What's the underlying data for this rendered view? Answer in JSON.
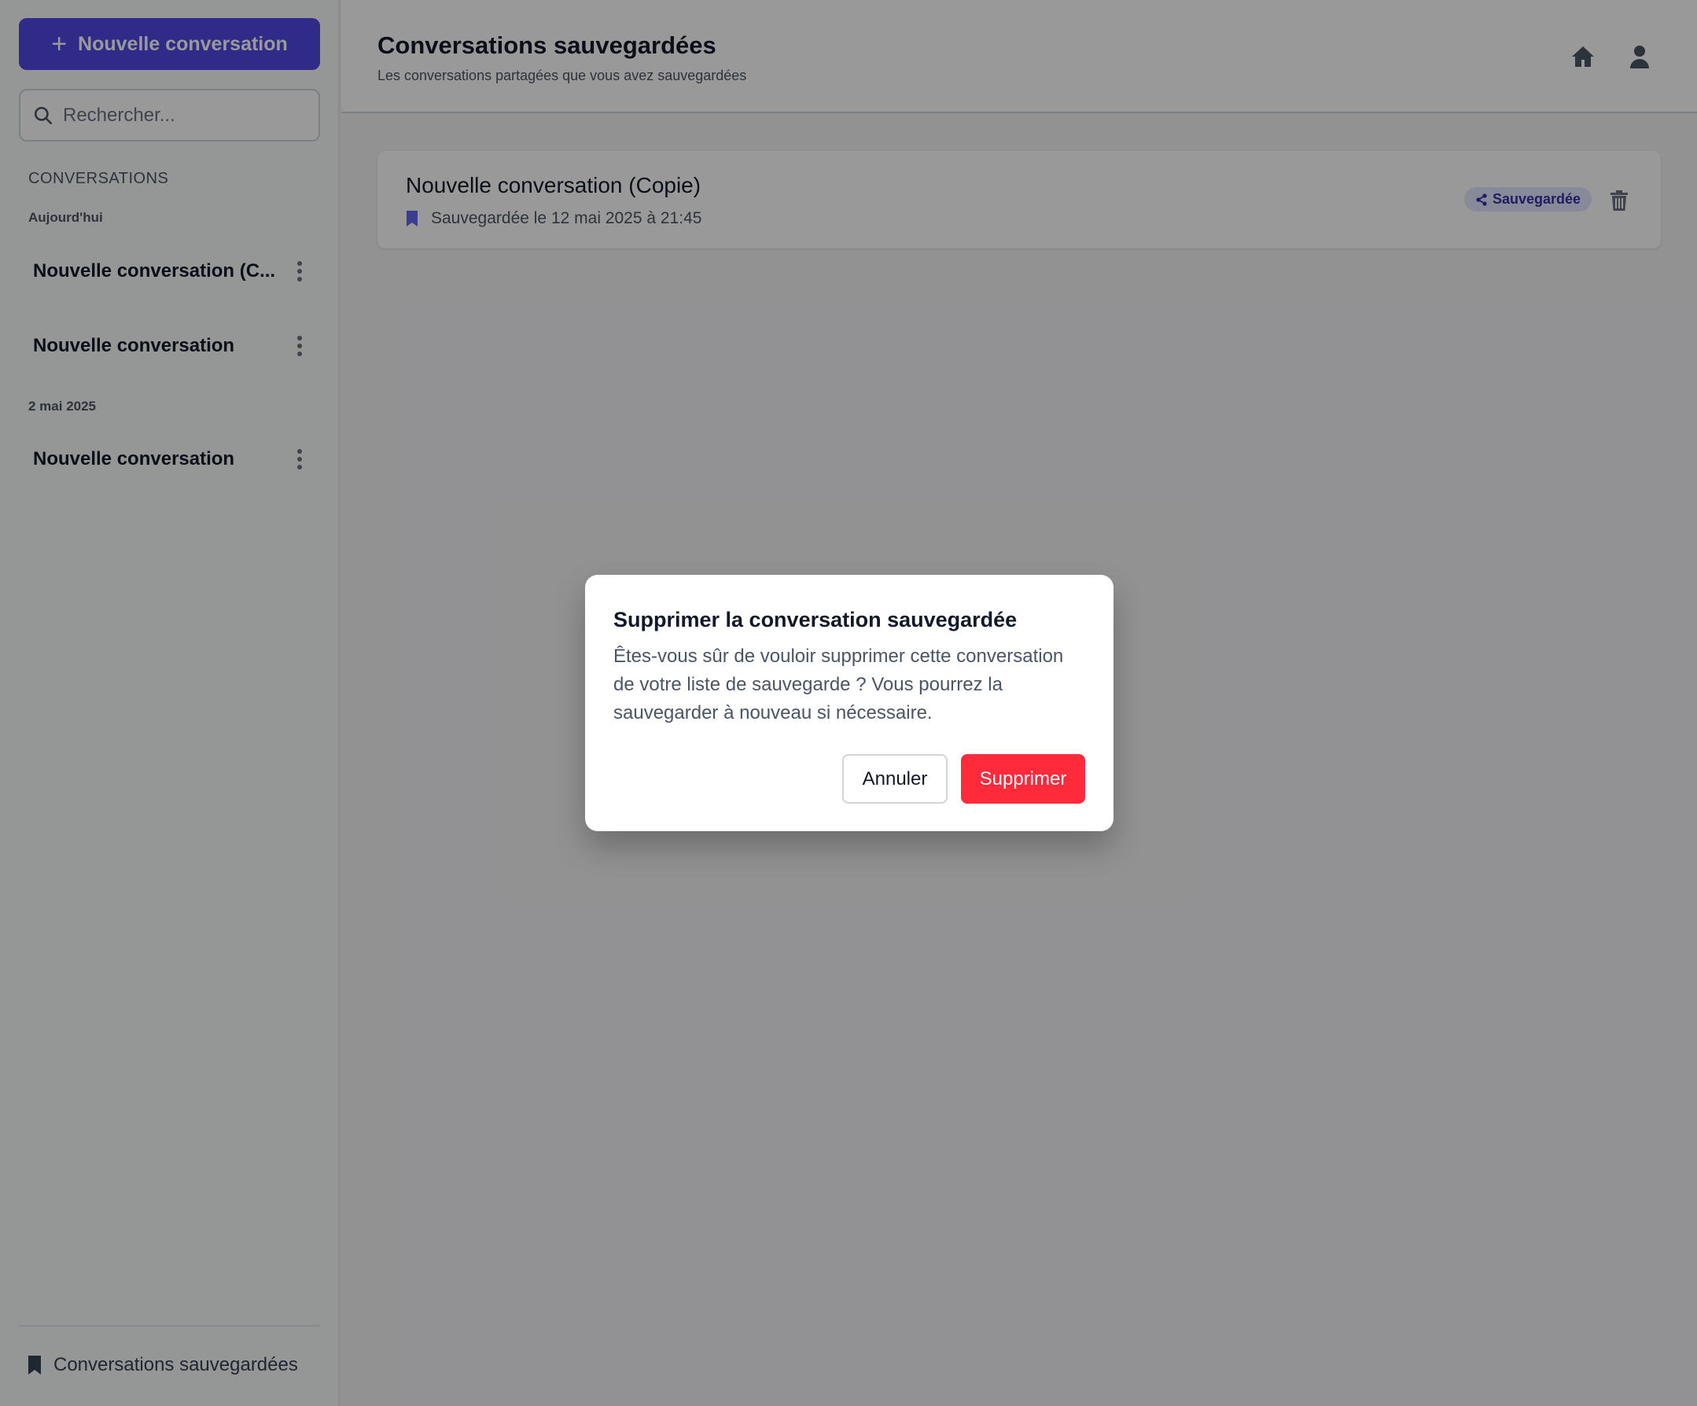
{
  "sidebar": {
    "new_button_label": "Nouvelle conversation",
    "search_placeholder": "Rechercher...",
    "section_label": "CONVERSATIONS",
    "groups": [
      {
        "label": "Aujourd'hui",
        "items": [
          "Nouvelle conversation (C...",
          "Nouvelle conversation"
        ]
      },
      {
        "label": "2 mai 2025",
        "items": [
          "Nouvelle conversation"
        ]
      }
    ],
    "saved_link_label": "Conversations sauvegardées"
  },
  "header": {
    "title": "Conversations sauvegardées",
    "subtitle": "Les conversations partagées que vous avez sauvegardées"
  },
  "saved_conversations": [
    {
      "title": "Nouvelle conversation (Copie)",
      "meta": "Sauvegardée le 12 mai 2025 à 21:45",
      "badge": "Sauvegardée"
    }
  ],
  "modal": {
    "title": "Supprimer la conversation sauvegardée",
    "message": "Êtes-vous sûr de vouloir supprimer cette conversation de votre liste de sauvegarde ? Vous pourrez la sauvegarder à nouveau si nécessaire.",
    "cancel_label": "Annuler",
    "confirm_label": "Supprimer"
  },
  "colors": {
    "accent": "#5046e5",
    "danger": "#ff2a3a",
    "badge_bg": "#e0e7ff",
    "badge_text": "#3730a3"
  },
  "icons": [
    "plus-icon",
    "search-icon",
    "kebab-icon",
    "bookmark-icon",
    "home-icon",
    "user-icon",
    "share-icon",
    "trash-icon"
  ]
}
